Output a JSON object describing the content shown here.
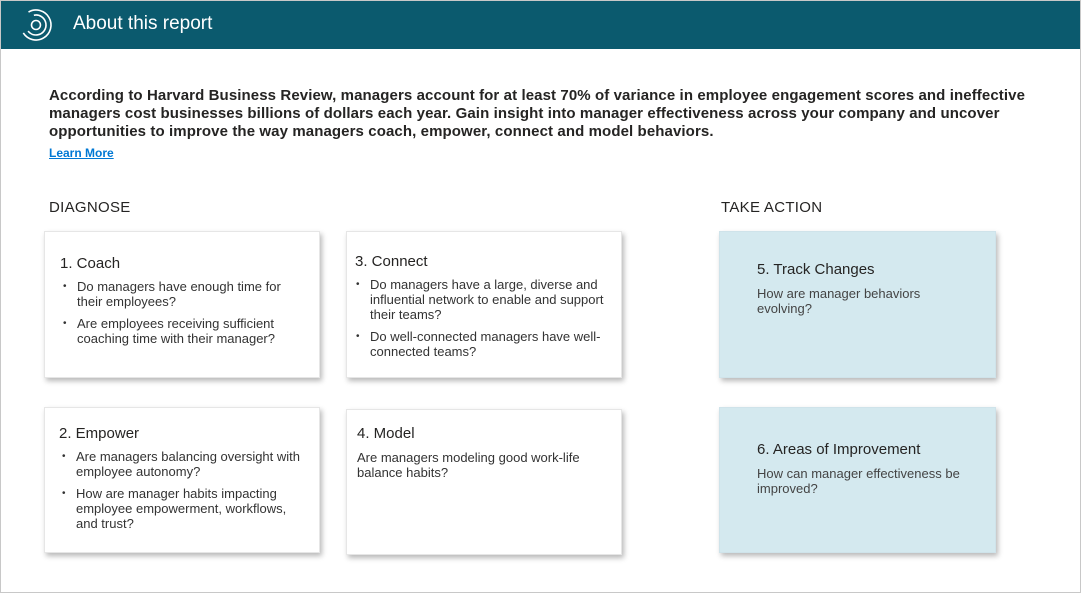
{
  "header": {
    "title": "About this report"
  },
  "intro": {
    "text": "According to Harvard Business Review, managers account for at least 70% of variance in employee engagement scores and ineffective managers cost businesses billions of dollars each year. Gain insight into manager effectiveness across your company and uncover opportunities to improve the way managers coach, empower, connect and model behaviors.",
    "learn_more": "Learn More"
  },
  "sections": {
    "diagnose": "DIAGNOSE",
    "take_action": "TAKE ACTION"
  },
  "cards": {
    "coach": {
      "title": "1. Coach",
      "items": [
        "Do managers have enough time for their employees?",
        "Are employees receiving sufficient coaching time with their manager?"
      ]
    },
    "connect": {
      "title": "3. Connect",
      "items": [
        "Do managers have a large, diverse and influential network to enable and support their teams?",
        "Do well-connected managers have well-connected teams?"
      ]
    },
    "empower": {
      "title": "2. Empower",
      "items": [
        "Are managers balancing oversight with employee autonomy?",
        "How are manager habits impacting employee empowerment, workflows, and trust?"
      ]
    },
    "model": {
      "title": "4. Model",
      "text": "Are managers modeling good work-life balance habits?"
    },
    "track": {
      "title": "5. Track Changes",
      "text": "How are manager behaviors evolving?"
    },
    "improve": {
      "title": "6. Areas of Improvement",
      "text": "How can manager effectiveness be improved?"
    }
  },
  "colors": {
    "header_bg": "#0b5a6e",
    "action_card_bg": "#d4e9ef",
    "link": "#0078d4"
  }
}
